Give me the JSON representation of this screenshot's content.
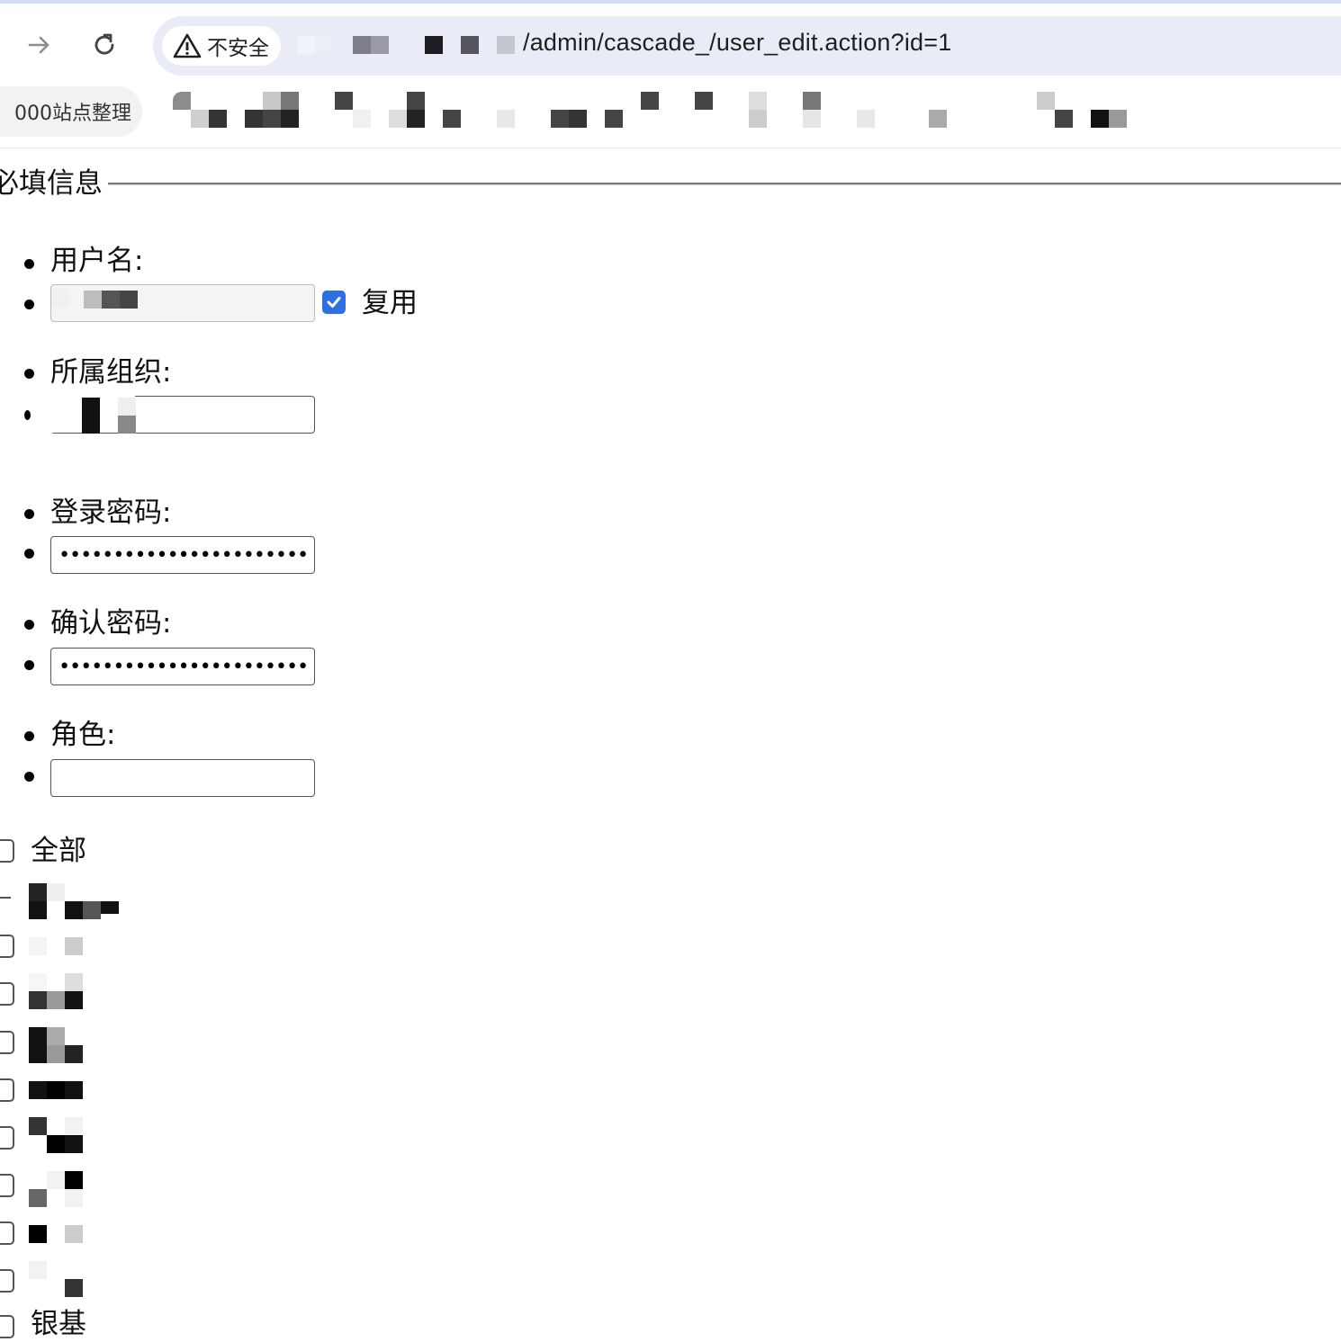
{
  "browser": {
    "security_label": "不安全",
    "url_path": "/admin/cascade_/user_edit.action?id=1",
    "bookmark_label": "000站点整理"
  },
  "form": {
    "section_title": "必填信息",
    "username_label": "用户名:",
    "reuse_label": "复用",
    "reuse_checked": true,
    "org_label": "所属组织:",
    "password_label": "登录密码:",
    "password_value": "••••••••••••••••••••••••••••••",
    "confirm_label": "确认密码:",
    "confirm_value": "••••••••••••••••••••••••••••••",
    "role_label": "角色:",
    "role_value": ""
  },
  "role_list": {
    "all_label": "全部",
    "item_count_visible": 9,
    "last_label_partial": "银基"
  },
  "colors": {
    "accent": "#2f6fe4",
    "omnibox_bg": "#e9ecf6",
    "top_stripe": "#d3dcf6"
  }
}
